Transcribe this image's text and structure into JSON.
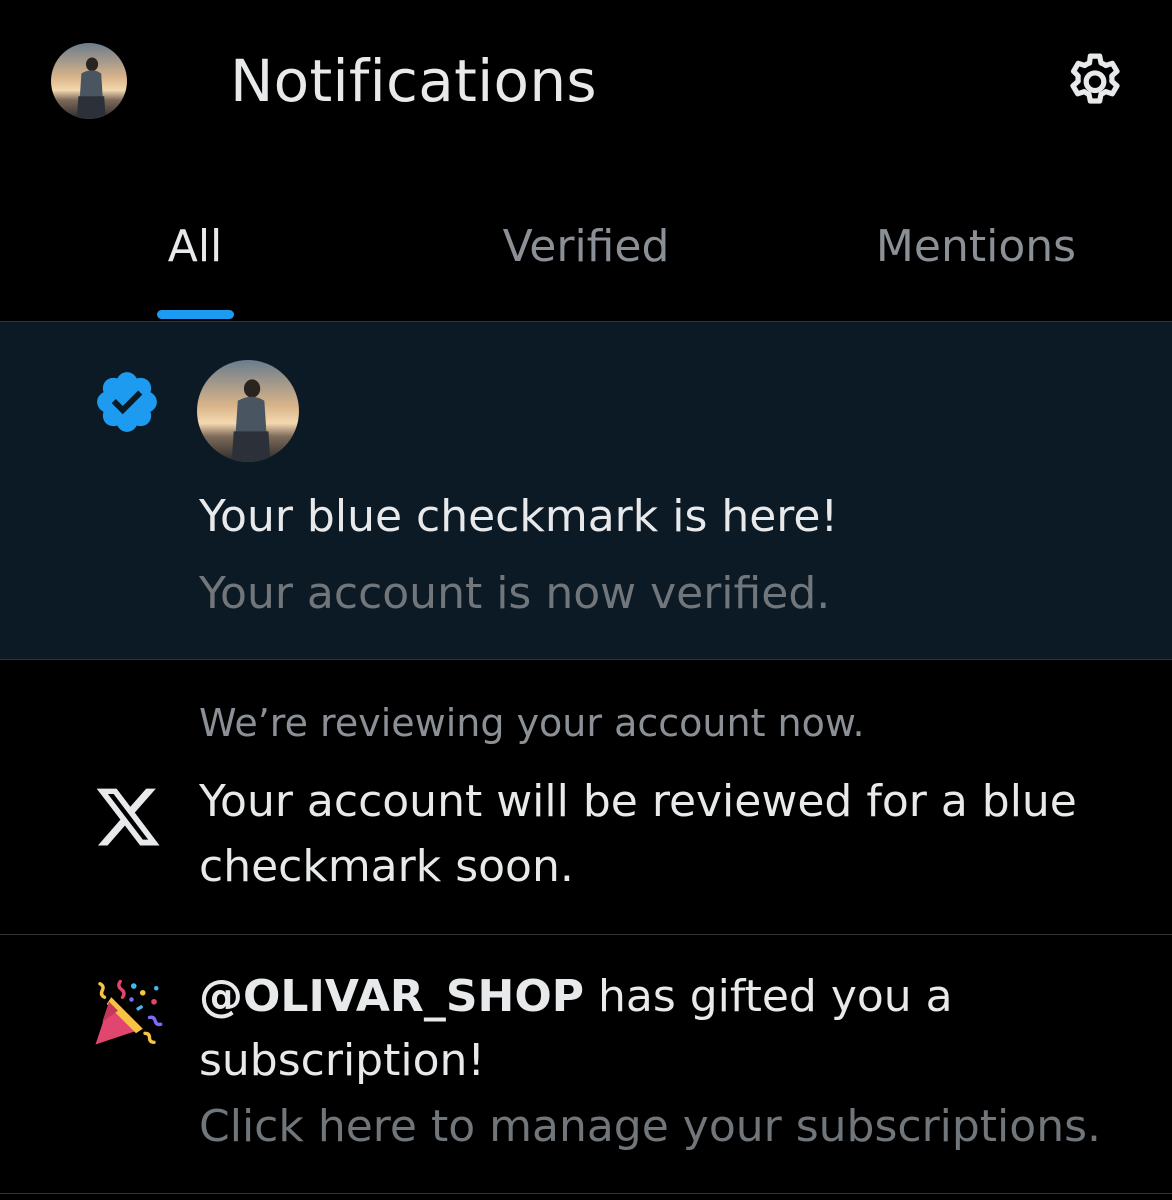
{
  "header": {
    "title": "Notifications",
    "settings_icon": "gear-icon",
    "avatar_icon": "profile-avatar"
  },
  "tabs": [
    {
      "label": "All",
      "active": true
    },
    {
      "label": "Verified",
      "active": false
    },
    {
      "label": "Mentions",
      "active": false
    }
  ],
  "colors": {
    "accent": "#1d9bf0",
    "background": "#000000",
    "unread_background": "#0c1a26",
    "primary_text": "#e7e9ea",
    "secondary_text": "#71767b",
    "divider": "#2f3336"
  },
  "notifications": [
    {
      "icon": "verified-badge-icon",
      "title": "Your blue checkmark is here!",
      "subtitle": "Your account is now verified."
    },
    {
      "icon": "x-logo-icon",
      "header": "We’re reviewing your account now.",
      "body_line1": "Your account will be reviewed for a blue",
      "body_line2": "checkmark soon."
    },
    {
      "icon": "party-popper-icon",
      "username": "@OLIVAR_SHOP",
      "body_after_username": " has gifted you a",
      "body_line2": "subscription!",
      "subtitle": "Click here to manage your subscriptions."
    }
  ]
}
